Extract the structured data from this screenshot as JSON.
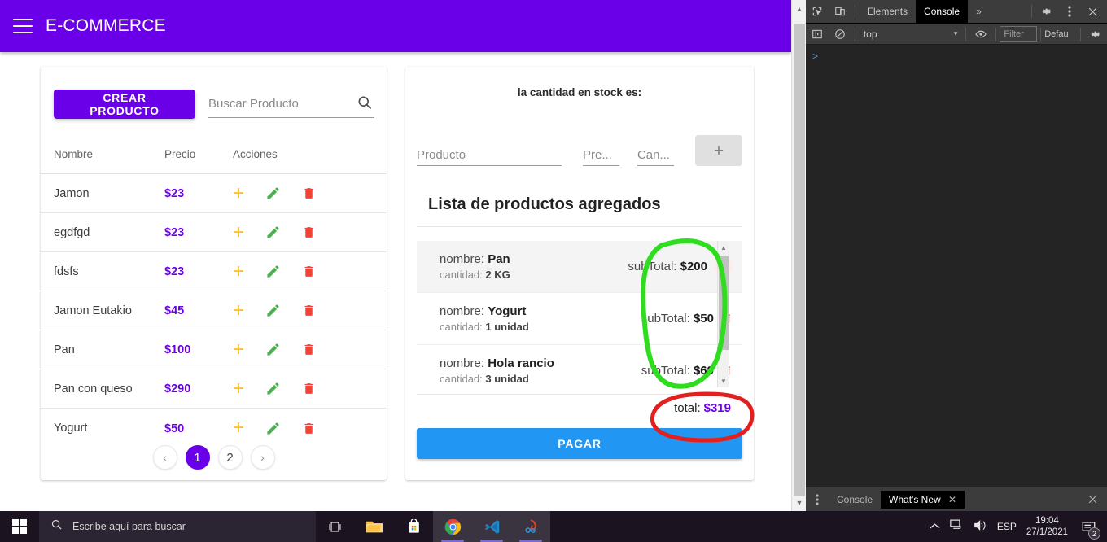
{
  "app": {
    "title": "E-COMMERCE",
    "menu_icon": "hamburger-icon"
  },
  "products_panel": {
    "create_button": "CREAR PRODUCTO",
    "search_placeholder": "Buscar Producto",
    "search_value": "",
    "search_icon": "search-icon",
    "columns": [
      "Nombre",
      "Precio",
      "Acciones"
    ],
    "rows": [
      {
        "nombre": "Jamon",
        "precio": "$23"
      },
      {
        "nombre": "egdfgd",
        "precio": "$23"
      },
      {
        "nombre": "fdsfs",
        "precio": "$23"
      },
      {
        "nombre": "Jamon Eutakio",
        "precio": "$45"
      },
      {
        "nombre": "Pan",
        "precio": "$100"
      },
      {
        "nombre": "Pan con queso",
        "precio": "$290"
      },
      {
        "nombre": "Yogurt",
        "precio": "$50"
      }
    ],
    "action_icons": [
      "add-icon",
      "edit-icon",
      "delete-icon"
    ],
    "pagination": {
      "prev": "‹",
      "pages": [
        "1",
        "2"
      ],
      "active_page": "1",
      "next": "›"
    }
  },
  "cart_panel": {
    "stock_label": "la cantidad en stock es:",
    "form": {
      "producto_placeholder": "Producto",
      "producto_value": "",
      "precio_placeholder": "Pre...",
      "precio_value": "",
      "cantidad_placeholder": "Can...",
      "cantidad_value": "",
      "add_button": "+"
    },
    "list_title": "Lista de productos agregados",
    "items": [
      {
        "nombre_label": "nombre:",
        "nombre": "Pan",
        "cantidad_label": "cantidad:",
        "cantidad": "2 KG",
        "subtotal_label": "subTotal:",
        "subtotal": "$200",
        "selected": true
      },
      {
        "nombre_label": "nombre:",
        "nombre": "Yogurt",
        "cantidad_label": "cantidad:",
        "cantidad": "1 unidad",
        "subtotal_label": "subTotal:",
        "subtotal": "$50",
        "selected": false
      },
      {
        "nombre_label": "nombre:",
        "nombre": "Hola rancio",
        "cantidad_label": "cantidad:",
        "cantidad": "3 unidad",
        "subtotal_label": "subTotal:",
        "subtotal": "$69",
        "selected": false
      }
    ],
    "total_label": "total:",
    "total_value": "$319",
    "pay_button": "PAGAR"
  },
  "annotations": {
    "green_circle_color": "#2fdd1f",
    "red_circle_color": "#e32020"
  },
  "devtools": {
    "toolbar_icons": [
      "inspect-element-icon",
      "device-toolbar-icon"
    ],
    "tabs": [
      {
        "label": "Elements",
        "active": false
      },
      {
        "label": "Console",
        "active": true
      }
    ],
    "more_tabs": "»",
    "settings_icon": "gear-icon",
    "more_options_icon": "kebab-menu-icon",
    "close_icon": "close-icon",
    "subbar": {
      "sidebar_icon": "console-sidebar-icon",
      "clear_icon": "clear-console-icon",
      "context": "top",
      "context_chevron": "▾",
      "eye_icon": "live-expression-icon",
      "filter_placeholder": "Filter",
      "levels": "Defau",
      "settings_icon": "gear-icon"
    },
    "prompt": ">",
    "drawer": {
      "more_icon": "kebab-menu-icon",
      "tabs": [
        {
          "label": "Console",
          "active": false,
          "closable": false
        },
        {
          "label": "What's New",
          "active": true,
          "closable": true
        }
      ],
      "close_icon": "close-icon"
    }
  },
  "taskbar": {
    "start_icon": "windows-start-icon",
    "search_icon": "search-icon",
    "search_placeholder": "Escribe aquí para buscar",
    "apps": [
      {
        "name": "task-view-icon",
        "active": false
      },
      {
        "name": "file-explorer-icon",
        "active": false
      },
      {
        "name": "microsoft-store-icon",
        "active": false
      },
      {
        "name": "google-chrome-icon",
        "active": true
      },
      {
        "name": "vs-code-icon",
        "active": true
      },
      {
        "name": "snipping-tool-icon",
        "active": true
      }
    ],
    "tray": {
      "chevron_up_icon": "show-hidden-icons-icon",
      "network_icon": "network-icon",
      "volume_icon": "volume-icon",
      "language": "ESP",
      "time": "19:04",
      "date": "27/1/2021",
      "notifications_icon": "action-center-icon",
      "notifications_count": "2"
    }
  }
}
